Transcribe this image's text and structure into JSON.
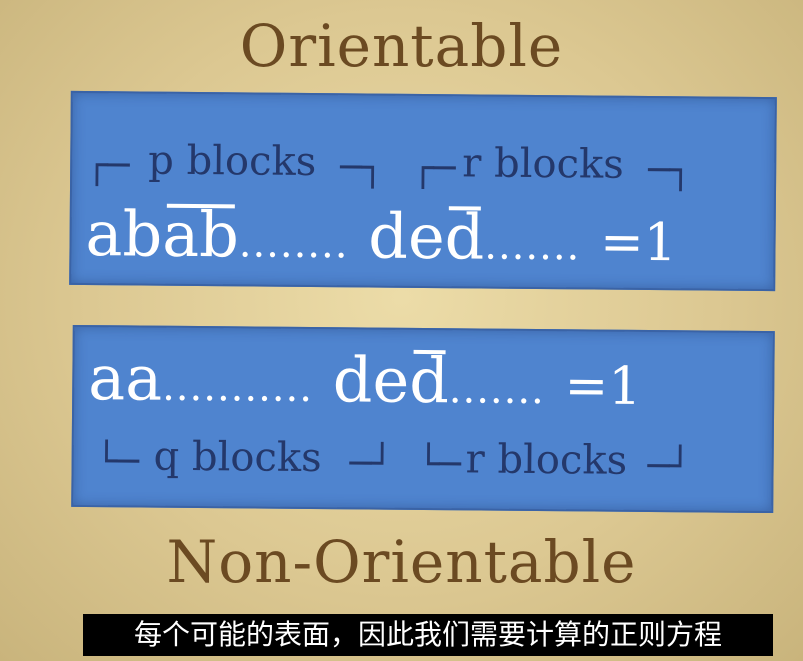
{
  "titles": {
    "top": "Orientable",
    "bottom": "Non-Orientable"
  },
  "orientable": {
    "p_label": "p blocks",
    "r_label": "r blocks",
    "word_a": "ab",
    "word_b": "ab",
    "dots1": "........",
    "word_c": "de",
    "word_d": "d",
    "dots2": ".......",
    "eq_one": "=1"
  },
  "non_orientable": {
    "q_label": "q blocks",
    "r_label": "r blocks",
    "word_a": "aa",
    "dots1": "...........",
    "word_c": "de",
    "word_d": "d",
    "dots2": ".......",
    "eq_one": "=1"
  },
  "subtitle": "每个可能的表面，因此我们需要计算的正则方程"
}
